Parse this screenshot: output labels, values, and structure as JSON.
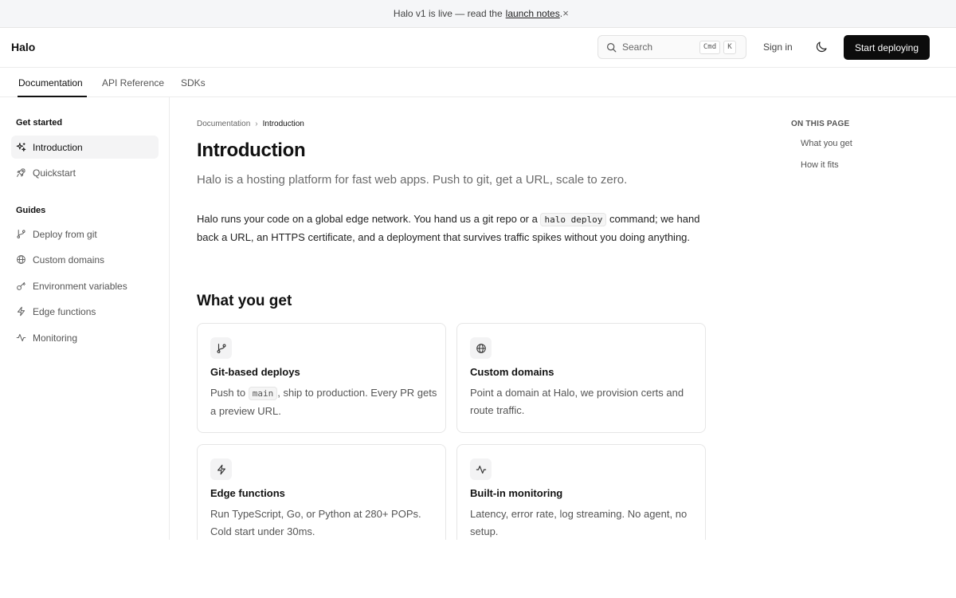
{
  "banner": {
    "text": "Halo v1 is live — read the",
    "link": "launch notes",
    "trailing": ".",
    "close_glyph": "×"
  },
  "header": {
    "logo": "Halo",
    "search_placeholder": "Search",
    "kbd_cmd": "Cmd",
    "kbd_k": "K",
    "signin": "Sign in",
    "cta": "Start deploying"
  },
  "tabs": [
    {
      "label": "Documentation",
      "active": true
    },
    {
      "label": "API Reference",
      "active": false
    },
    {
      "label": "SDKs",
      "active": false
    }
  ],
  "sidebar": {
    "groups": [
      {
        "heading": "Get started",
        "items": [
          {
            "label": "Introduction",
            "icon": "sparkles-icon",
            "active": true
          },
          {
            "label": "Quickstart",
            "icon": "rocket-icon",
            "active": false
          }
        ]
      },
      {
        "heading": "Guides",
        "items": [
          {
            "label": "Deploy from git",
            "icon": "git-branch-icon",
            "active": false
          },
          {
            "label": "Custom domains",
            "icon": "globe-icon",
            "active": false
          },
          {
            "label": "Environment variables",
            "icon": "key-icon",
            "active": false
          },
          {
            "label": "Edge functions",
            "icon": "zap-icon",
            "active": false
          },
          {
            "label": "Monitoring",
            "icon": "activity-icon",
            "active": false
          }
        ]
      }
    ]
  },
  "main": {
    "breadcrumb": {
      "parent": "Documentation",
      "separator": "›",
      "current": "Introduction"
    },
    "title": "Introduction",
    "lede": "Halo is a hosting platform for fast web apps. Push to git, get a URL, scale to zero.",
    "body_before": "Halo runs your code on a global edge network. You hand us a git repo or a",
    "body_code": "halo deploy",
    "body_after": "command; we hand back a URL, an HTTPS certificate, and a deployment that survives traffic spikes without you doing anything.",
    "section_title": "What you get",
    "cards": [
      {
        "title": "Git-based deploys",
        "icon": "git-branch-icon",
        "desc_before": "Push to",
        "desc_code": "main",
        "desc_after": ", ship to production. Every PR gets a preview URL."
      },
      {
        "title": "Custom domains",
        "icon": "globe-icon",
        "desc": "Point a domain at Halo, we provision certs and route traffic."
      },
      {
        "title": "Edge functions",
        "icon": "zap-icon",
        "desc": "Run TypeScript, Go, or Python at 280+ POPs. Cold start under 30ms."
      },
      {
        "title": "Built-in monitoring",
        "icon": "activity-icon",
        "desc": "Latency, error rate, log streaming. No agent, no setup."
      }
    ]
  },
  "toc": {
    "heading": "ON THIS PAGE",
    "items": [
      "What you get",
      "How it fits"
    ]
  },
  "colors": {
    "accent": "#0c0c0c",
    "active_item_bg": "#f4f4f5",
    "banner_bg": "#f5f6f8"
  }
}
